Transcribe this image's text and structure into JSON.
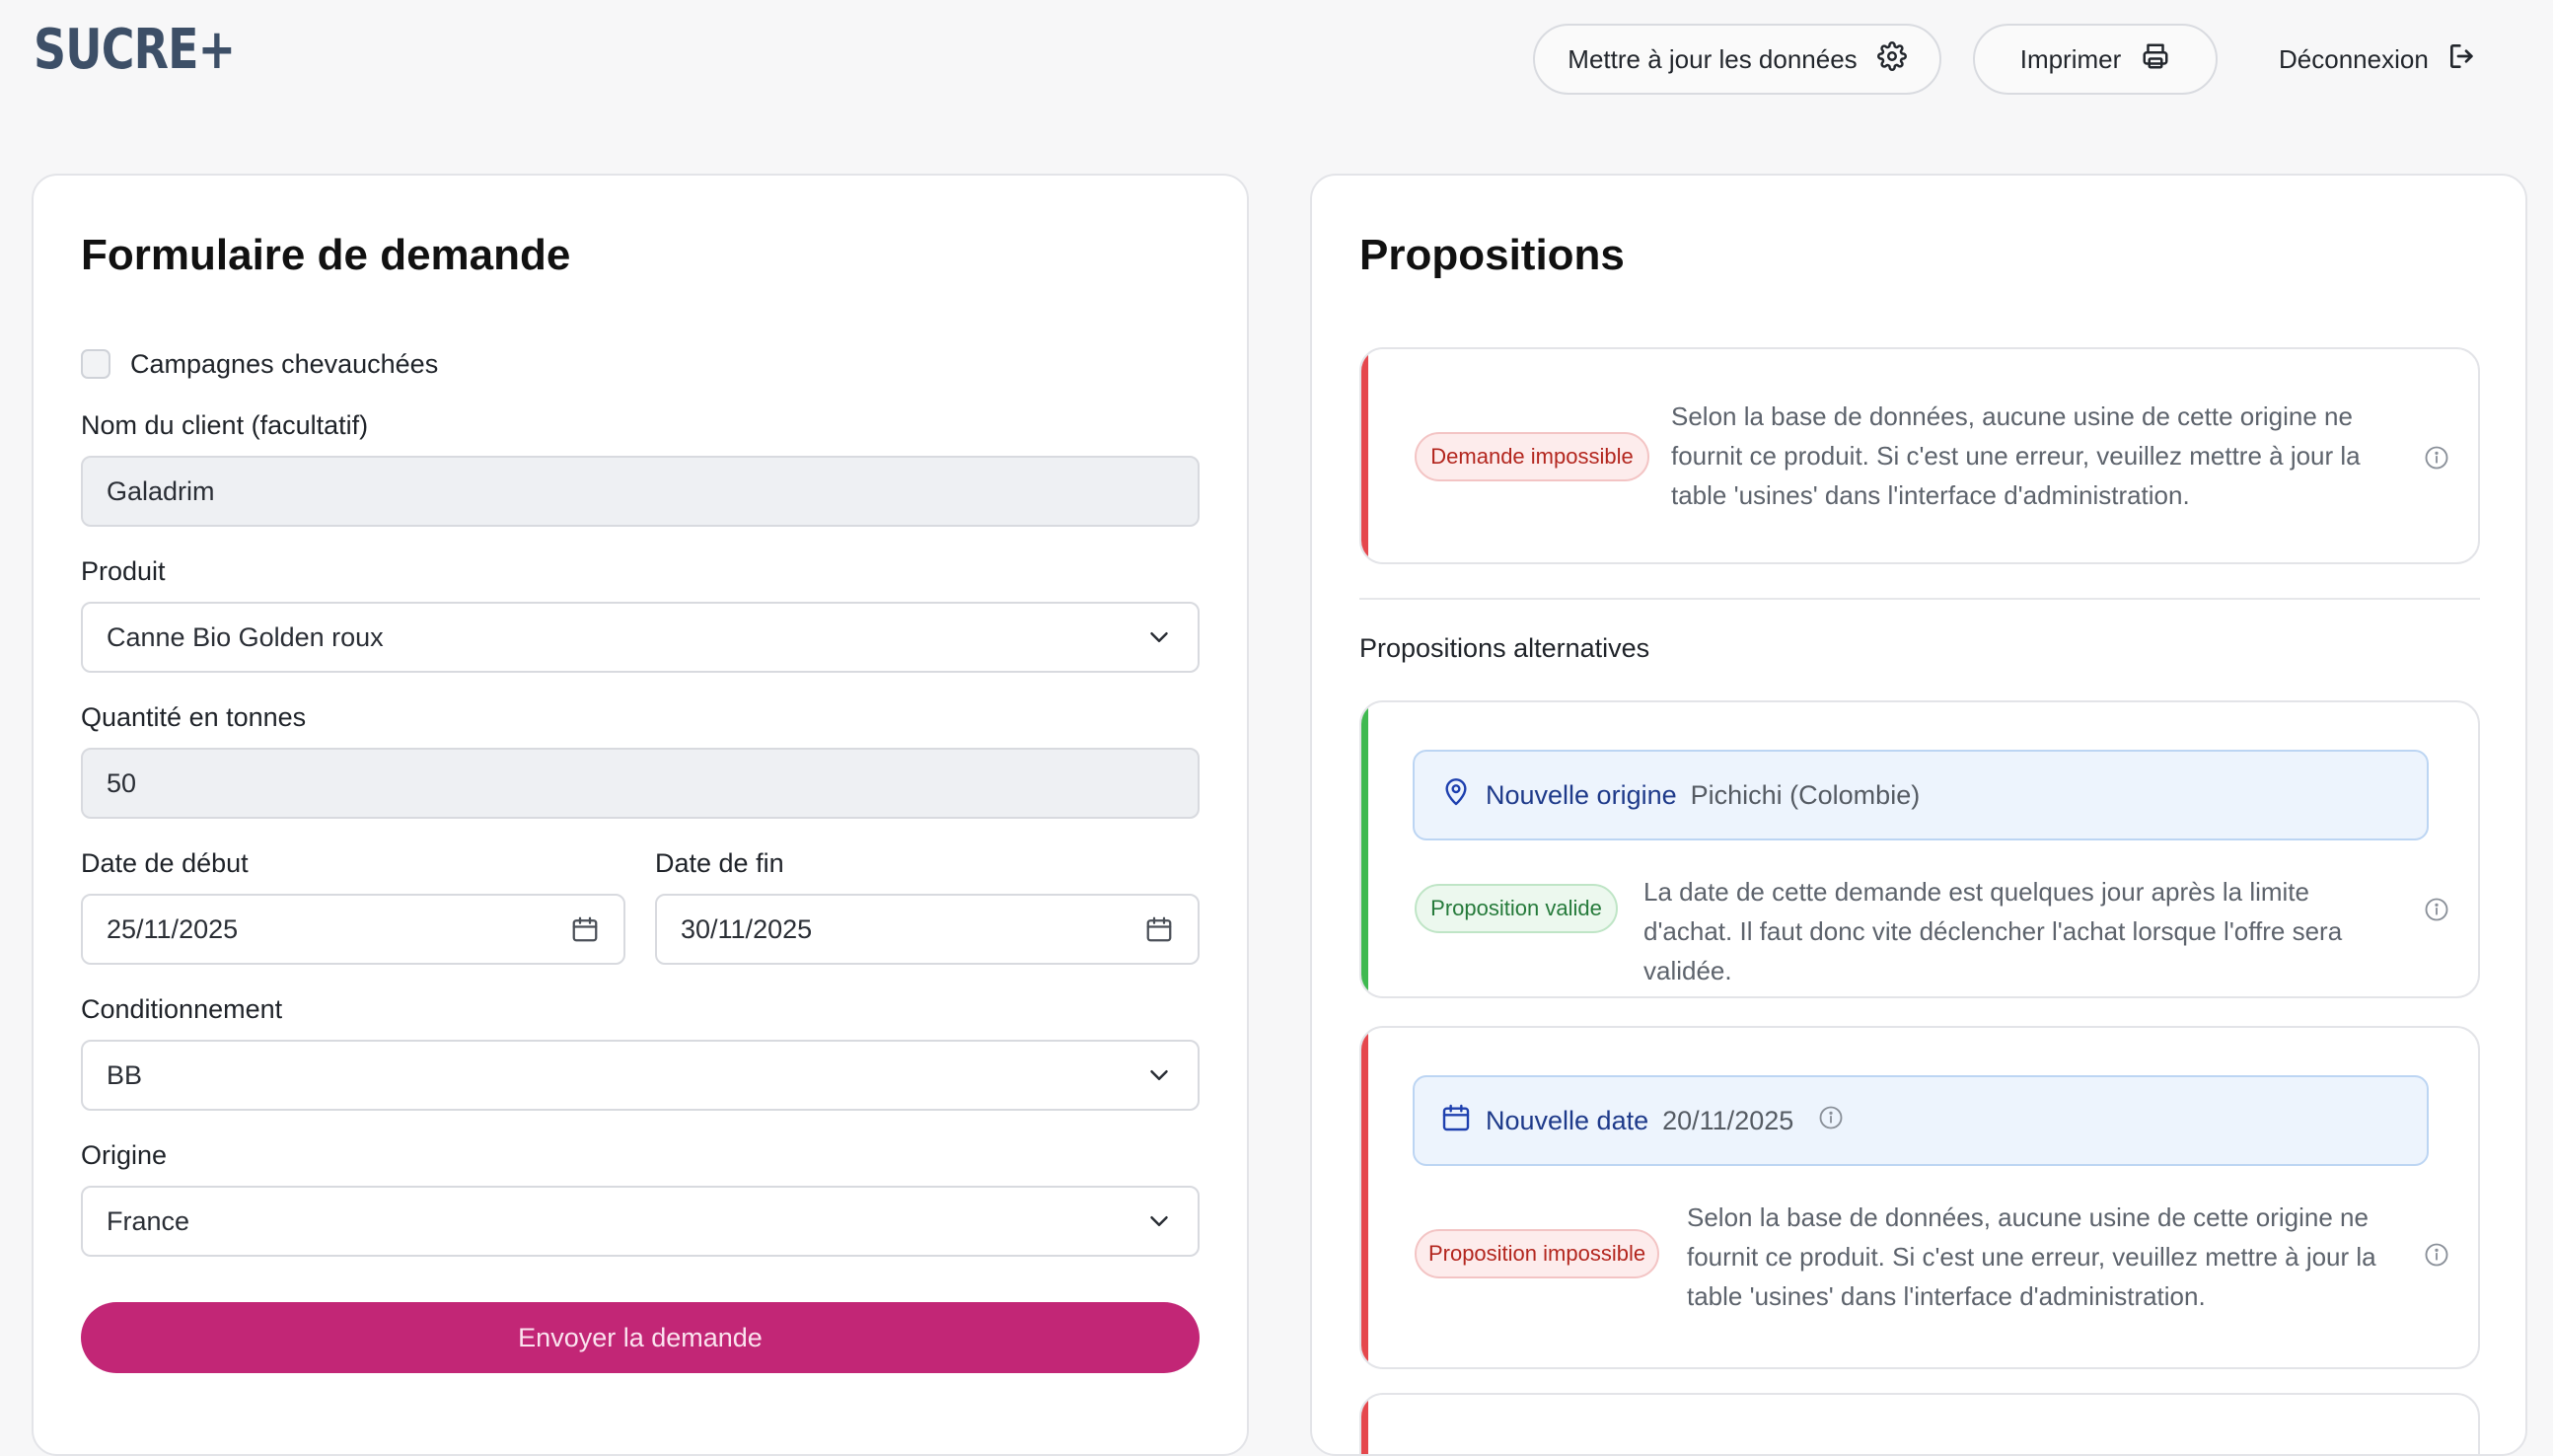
{
  "brand": {
    "logo": "SUCRE+"
  },
  "header": {
    "update_label": "Mettre à jour les données",
    "print_label": "Imprimer",
    "logout_label": "Déconnexion"
  },
  "form": {
    "title": "Formulaire de demande",
    "overlap_label": "Campagnes chevauchées",
    "overlap_checked": false,
    "client_label": "Nom du client (facultatif)",
    "client_value": "Galadrim",
    "product_label": "Produit",
    "product_value": "Canne Bio Golden roux",
    "quantity_label": "Quantité en tonnes",
    "quantity_value": "50",
    "start_label": "Date de début",
    "start_value": "25/11/2025",
    "end_label": "Date de fin",
    "end_value": "30/11/2025",
    "packaging_label": "Conditionnement",
    "packaging_value": "BB",
    "origin_label": "Origine",
    "origin_value": "France",
    "submit_label": "Envoyer la demande"
  },
  "propositions": {
    "title": "Propositions",
    "main": {
      "badge": "Demande impossible",
      "status_color": "#e5484d",
      "text": "Selon la base de données, aucune usine de cette origine ne fournit ce produit. Si c'est une erreur, veuillez mettre à jour la table 'usines' dans l'interface d'administration."
    },
    "alternatives_title": "Propositions alternatives",
    "alternatives": [
      {
        "kind_label": "Nouvelle origine",
        "kind_value": "Pichichi (Colombie)",
        "kind_icon": "map-pin-icon",
        "badge": "Proposition valide",
        "status_color": "#3fb950",
        "text": "La date de cette demande est quelques jour après la limite d'achat. Il faut donc vite déclencher l'achat lorsque l'offre sera validée."
      },
      {
        "kind_label": "Nouvelle date",
        "kind_value": "20/11/2025",
        "kind_icon": "calendar-icon",
        "badge": "Proposition impossible",
        "status_color": "#e5484d",
        "text": "Selon la base de données, aucune usine de cette origine ne fournit ce produit. Si c'est une erreur, veuillez mettre à jour la table 'usines' dans l'interface d'administration."
      }
    ]
  }
}
